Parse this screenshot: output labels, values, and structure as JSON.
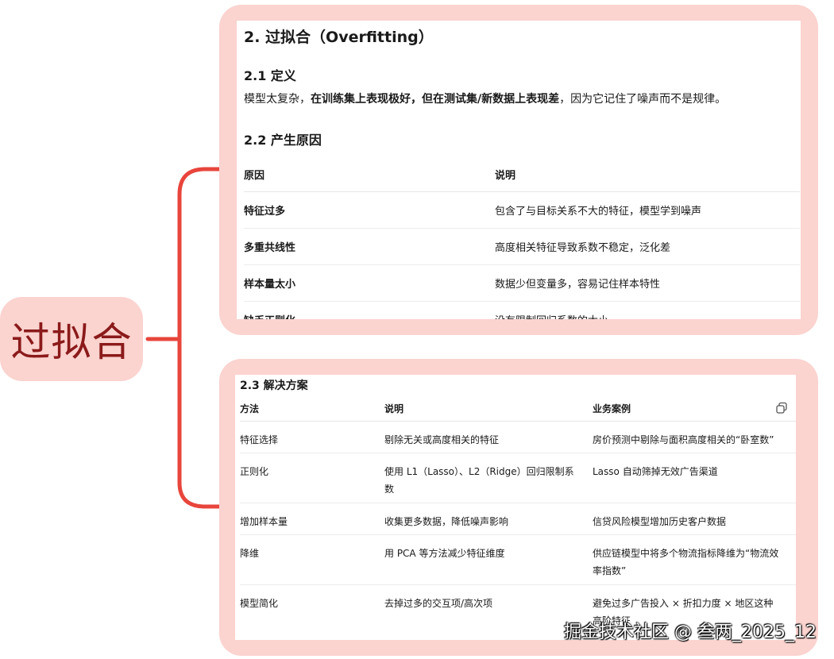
{
  "root": {
    "label": "过拟合"
  },
  "section1": {
    "title": "2. 过拟合（Overfitting）",
    "definition_heading": "2.1 定义",
    "definition_pre": "模型太复杂，",
    "definition_bold": "在训练集上表现极好，但在测试集/新数据上表现差",
    "definition_post": "，因为它记住了噪声而不是规律。",
    "causes_heading": "2.2 产生原因",
    "causes_table": {
      "headers": [
        "原因",
        "说明"
      ],
      "rows": [
        [
          "特征过多",
          "包含了与目标关系不大的特征，模型学到噪声"
        ],
        [
          "多重共线性",
          "高度相关特征导致系数不稳定，泛化差"
        ],
        [
          "样本量太小",
          "数据少但变量多，容易记住样本特性"
        ],
        [
          "缺乏正则化",
          "没有限制回归系数的大小"
        ]
      ]
    }
  },
  "section2": {
    "title": "2.3 解决方案",
    "solutions_table": {
      "headers": [
        "方法",
        "说明",
        "业务案例"
      ],
      "rows": [
        [
          "特征选择",
          "剔除无关或高度相关的特征",
          "房价预测中剔除与面积高度相关的“卧室数”"
        ],
        [
          "正则化",
          "使用 L1（Lasso）、L2（Ridge）回归限制系数",
          "Lasso 自动筛掉无效广告渠道"
        ],
        [
          "增加样本量",
          "收集更多数据，降低噪声影响",
          "信贷风险模型增加历史客户数据"
        ],
        [
          "降维",
          "用 PCA 等方法减少特征维度",
          "供应链模型中将多个物流指标降维为“物流效率指数”"
        ],
        [
          "模型简化",
          "去掉过多的交互项/高次项",
          "避免过多广告投入 × 折扣力度 × 地区这种高阶特征"
        ]
      ]
    },
    "copy_icon": "copy-icon"
  },
  "watermark": "掘金技术社区 @ 叁两_2025_12",
  "colors": {
    "card_bg": "#fbd3cf",
    "connector": "#e8453c",
    "root_text": "#8b1a1a"
  }
}
